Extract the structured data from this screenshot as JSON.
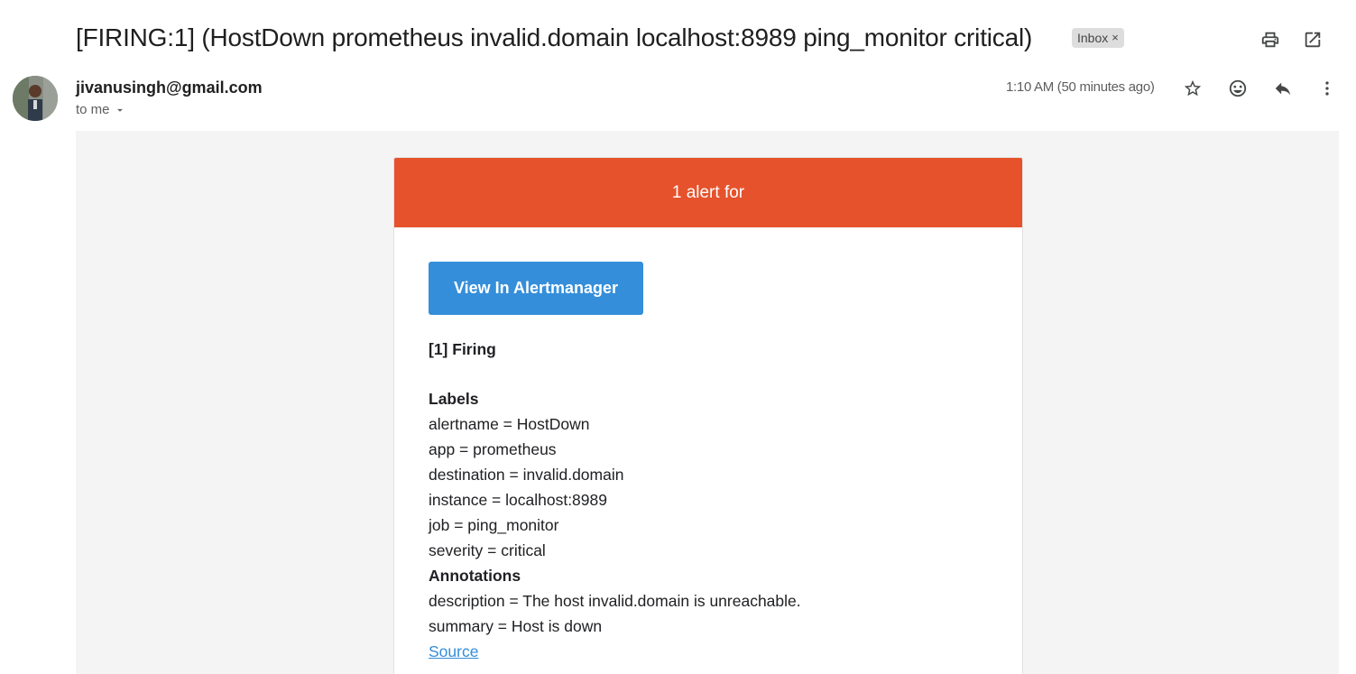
{
  "email": {
    "subject": "[FIRING:1] (HostDown prometheus invalid.domain localhost:8989 ping_monitor critical)",
    "label_chip": "Inbox",
    "label_chip_remove": "×",
    "sender": "jivanusingh@gmail.com",
    "recipient": "to me",
    "time": "1:10 AM (50 minutes ago)"
  },
  "toolbar_icons": [
    "print-icon",
    "open-in-new-window-icon",
    "star-icon",
    "emoji-react-icon",
    "reply-icon",
    "more-vert-icon"
  ],
  "alert": {
    "header": "1 alert for",
    "header_color": "#e6522c",
    "button_label": "View In Alertmanager",
    "button_color": "#348eda",
    "firing_title": "[1] Firing",
    "labels_title": "Labels",
    "labels": [
      "alertname = HostDown",
      "app = prometheus",
      "destination = invalid.domain",
      "instance = localhost:8989",
      "job = ping_monitor",
      "severity = critical"
    ],
    "annotations_title": "Annotations",
    "annotations": [
      "description = The host invalid.domain is unreachable.",
      "summary = Host is down"
    ],
    "source_link": "Source"
  }
}
